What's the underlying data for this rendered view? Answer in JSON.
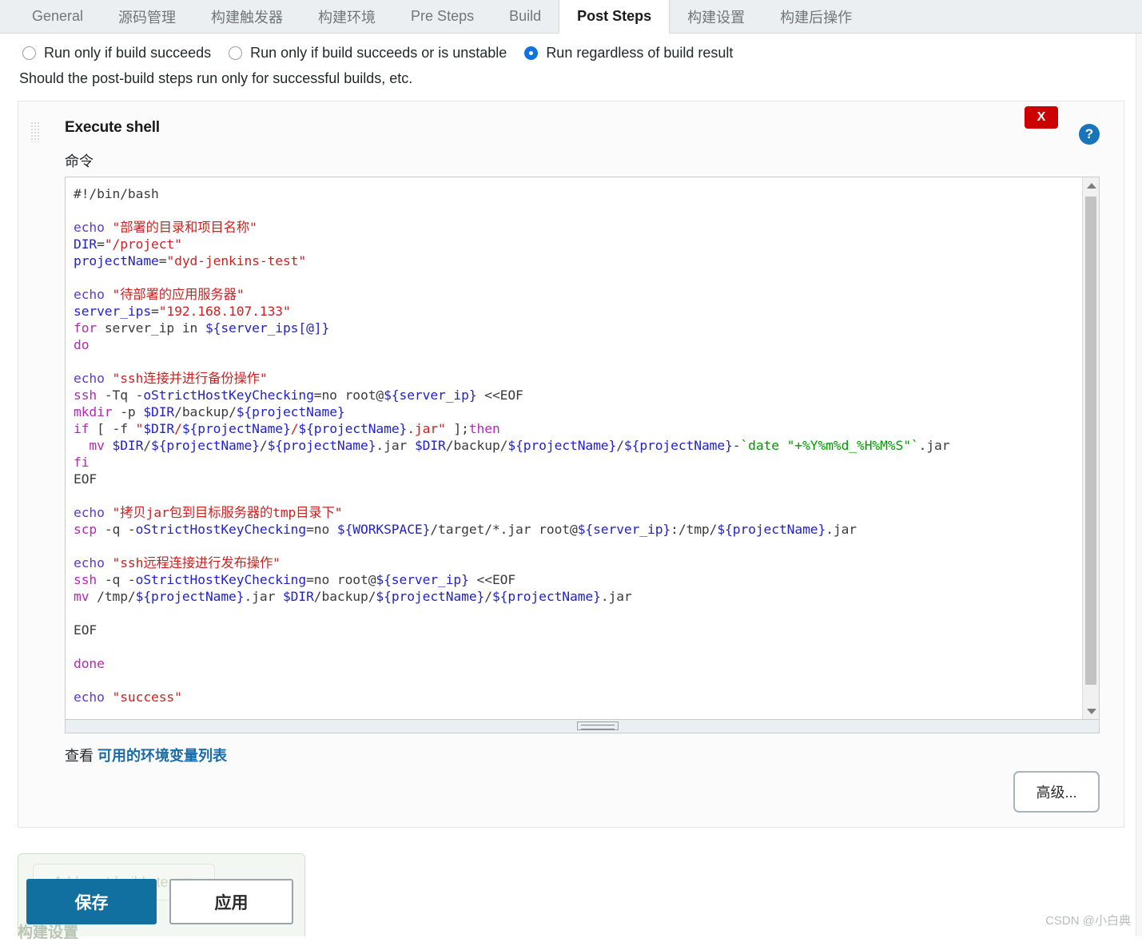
{
  "tabs": [
    {
      "label": "General",
      "active": false
    },
    {
      "label": "源码管理",
      "active": false
    },
    {
      "label": "构建触发器",
      "active": false
    },
    {
      "label": "构建环境",
      "active": false
    },
    {
      "label": "Pre Steps",
      "active": false
    },
    {
      "label": "Build",
      "active": false
    },
    {
      "label": "Post Steps",
      "active": true
    },
    {
      "label": "构建设置",
      "active": false
    },
    {
      "label": "构建后操作",
      "active": false
    }
  ],
  "run_condition": {
    "options": [
      {
        "label": "Run only if build succeeds",
        "checked": false
      },
      {
        "label": "Run only if build succeeds or is unstable",
        "checked": false
      },
      {
        "label": "Run regardless of build result",
        "checked": true
      }
    ],
    "hint": "Should the post-build steps run only for successful builds, etc."
  },
  "execute_shell": {
    "title": "Execute shell",
    "close_label": "X",
    "help_label": "?",
    "command_label": "命令",
    "advanced_label": "高级...",
    "env_prefix": "查看",
    "env_link": "可用的环境变量列表",
    "script": "#!/bin/bash\n\necho \"部署的目录和项目名称\"\nDIR=\"/project\"\nprojectName=\"dyd-jenkins-test\"\n\necho \"待部署的应用服务器\"\nserver_ips=\"192.168.107.133\"\nfor server_ip in ${server_ips[@]}\ndo\n\necho \"ssh连接并进行备份操作\"\nssh -Tq -oStrictHostKeyChecking=no root@${server_ip} <<EOF\nmkdir -p $DIR/backup/${projectName}\nif [ -f \"$DIR/${projectName}/${projectName}.jar\" ];then\n  mv $DIR/${projectName}/${projectName}.jar $DIR/backup/${projectName}/${projectName}-`date \"+%Y%m%d_%H%M%S\"`.jar\nfi\nEOF\n\necho \"拷贝jar包到目标服务器的tmp目录下\"\nscp -q -oStrictHostKeyChecking=no ${WORKSPACE}/target/*.jar root@${server_ip}:/tmp/${projectName}.jar\n\necho \"ssh远程连接进行发布操作\"\nssh -q -oStrictHostKeyChecking=no root@${server_ip} <<EOF\nmv /tmp/${projectName}.jar $DIR/backup/${projectName}/${projectName}.jar\n\nEOF\n\ndone\n\necho \"success\""
  },
  "footer": {
    "add_post_build_step": "Add post-build step ▼",
    "tail_label": "构建设置",
    "save_label": "保存",
    "apply_label": "应用",
    "watermark": "CSDN @小白典"
  },
  "colors": {
    "accent": "#1270a0",
    "danger": "#cc0000",
    "help": "#1a74ba",
    "link": "#1a6ca8",
    "radio_checked": "#1273de"
  }
}
